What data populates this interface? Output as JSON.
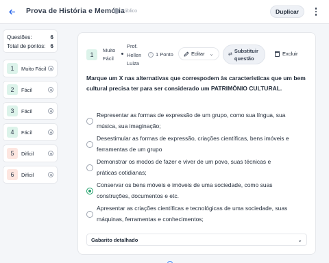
{
  "header": {
    "back_icon": "arrow-left-icon",
    "title": "Prova de História e Memória",
    "visibility_icon": "globe-icon",
    "visibility": "Público",
    "duplicate_label": "Duplicar",
    "menu_icon": "more-vertical-icon"
  },
  "summary": {
    "questions_label": "Questões:",
    "questions_value": "6",
    "points_label": "Total de pontos:",
    "points_value": "6"
  },
  "question_list": [
    {
      "number": "1",
      "difficulty": "Muito Fácil"
    },
    {
      "number": "2",
      "difficulty": "Fácil"
    },
    {
      "number": "3",
      "difficulty": "Fácil"
    },
    {
      "number": "4",
      "difficulty": "Fácil"
    },
    {
      "number": "5",
      "difficulty": "Difícil"
    },
    {
      "number": "6",
      "difficulty": "Difícil"
    }
  ],
  "question": {
    "number": "1",
    "difficulty_line1": "Muito",
    "difficulty_line2": "Fácil",
    "author_line1": "Prof.",
    "author_line2": "Hellen",
    "author_line3": "Luiza",
    "points": "1 Ponto",
    "edit_label": "Editar",
    "replace_line1": "Substituir",
    "replace_line2": "questão",
    "delete_label": "Excluir",
    "prompt": "Marque um X nas alternativas que correspodem às características que um bem cultural precisa ter para ser considerado um PATRIMÔNIO CULTURAL.",
    "options": [
      {
        "line1": "Representar as formas de expressão de um grupo, como sua língua, sua",
        "line2": "música, sua imaginação;",
        "checked": false
      },
      {
        "line1": "Desestimular as formas de expressão, criações científicas, bens imóveis e",
        "line2": "ferramentas de um grupo",
        "checked": false
      },
      {
        "line1": "Demonstrar os modos de fazer e viver de um povo, suas técnicas e",
        "line2": "práticas cotidianas;",
        "checked": false
      },
      {
        "line1": "Conservar os bens móveis e imóveis de uma sociedade, como suas",
        "line2": "construções, documentos e etc.",
        "checked": true
      },
      {
        "line1": "Apresentar as criações científicas e tecnológicas de uma sociedade, suas",
        "line2": "máquinas, ferramentas e conhecimentos;",
        "checked": false
      }
    ],
    "feedback_label": "Gabarito detalhado"
  },
  "colors": {
    "accent": "#2563eb",
    "easy_badge": "#dcf3ea",
    "hard_badge": "#fde6e0",
    "selected_radio": "#22a06b"
  }
}
